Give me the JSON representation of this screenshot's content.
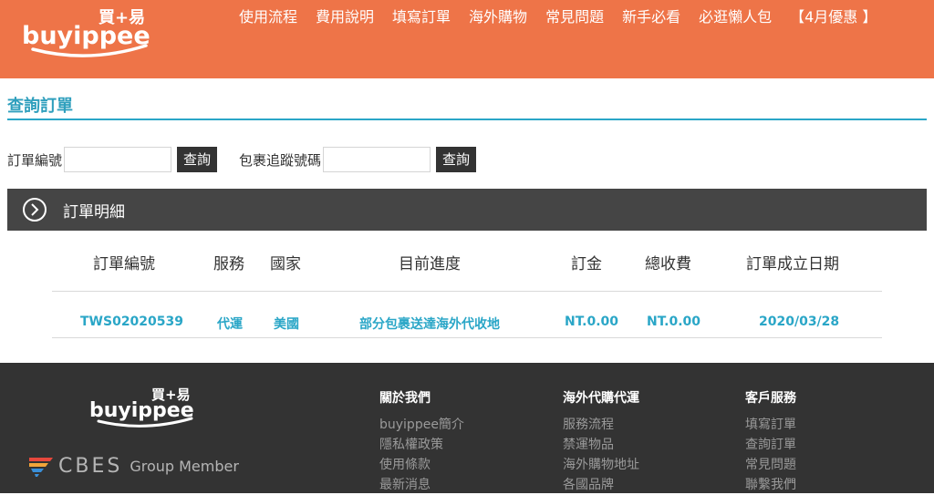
{
  "header": {
    "brand": {
      "name": "buyippee",
      "chinese": "買+易"
    },
    "nav": [
      "使用流程",
      "費用說明",
      "填寫訂單",
      "海外購物",
      "常見問題",
      "新手必看",
      "必逛懶人包",
      "【4月優惠 】"
    ]
  },
  "page": {
    "title": "查詢訂單"
  },
  "search": {
    "order_label": "訂單編號",
    "order_value": "",
    "order_button": "查詢",
    "tracking_label": "包裹追蹤號碼",
    "tracking_value": "",
    "tracking_button": "查詢"
  },
  "section": {
    "title": "訂單明細",
    "icon": "chevron-right-circle-icon"
  },
  "table": {
    "headers": [
      "訂單編號",
      "服務",
      "國家",
      "目前進度",
      "訂金",
      "總收費",
      "訂單成立日期"
    ],
    "rows": [
      [
        "TWS02020539",
        "代運",
        "美國",
        "部分包裹送達海外代收地",
        "NT.0.00",
        "NT.0.00",
        "2020/03/28"
      ]
    ]
  },
  "footer": {
    "brand": {
      "name": "buyippee",
      "chinese": "買+易"
    },
    "group": {
      "name": "CBES",
      "suffix": "Group Member"
    },
    "columns": [
      {
        "title": "關於我們",
        "links": [
          "buyippee簡介",
          "隱私權政策",
          "使用條款",
          "最新消息"
        ]
      },
      {
        "title": "海外代購代運",
        "links": [
          "服務流程",
          "禁運物品",
          "海外購物地址",
          "各國品牌"
        ]
      },
      {
        "title": "客戶服務",
        "links": [
          "填寫訂單",
          "查詢訂單",
          "常見問題",
          "聯繫我們"
        ]
      }
    ]
  },
  "colors": {
    "header": "#ee7448",
    "accent": "#2aa6c7",
    "bar": "#454545",
    "footer": "#333333"
  }
}
